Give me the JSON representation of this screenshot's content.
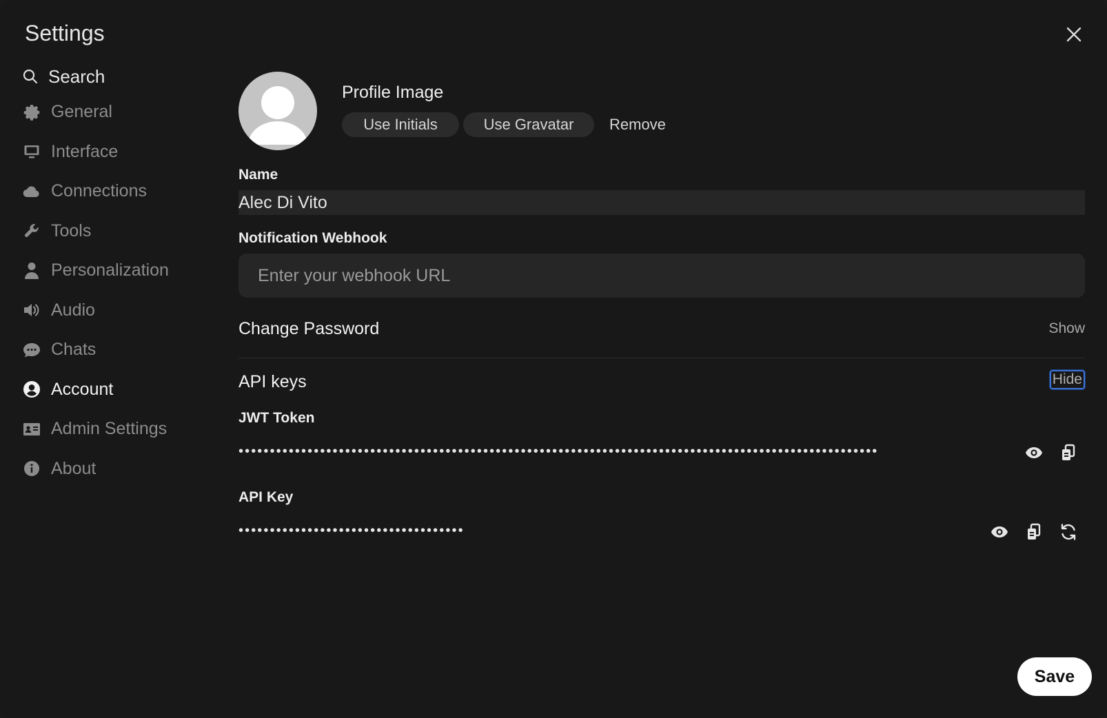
{
  "header": {
    "title": "Settings"
  },
  "sidebar": {
    "search_label": "Search",
    "items": [
      {
        "label": "General",
        "icon": "gear-icon"
      },
      {
        "label": "Interface",
        "icon": "monitor-icon"
      },
      {
        "label": "Connections",
        "icon": "cloud-icon"
      },
      {
        "label": "Tools",
        "icon": "wrench-icon"
      },
      {
        "label": "Personalization",
        "icon": "user-icon"
      },
      {
        "label": "Audio",
        "icon": "speaker-icon"
      },
      {
        "label": "Chats",
        "icon": "chat-bubble-icon"
      },
      {
        "label": "Account",
        "icon": "user-circle-icon"
      },
      {
        "label": "Admin Settings",
        "icon": "id-card-icon"
      },
      {
        "label": "About",
        "icon": "info-icon"
      }
    ],
    "active": "Account"
  },
  "profile": {
    "label": "Profile Image",
    "use_initials": "Use Initials",
    "use_gravatar": "Use Gravatar",
    "remove": "Remove"
  },
  "name": {
    "label": "Name",
    "value": "Alec Di Vito"
  },
  "webhook": {
    "label": "Notification Webhook",
    "placeholder": "Enter your webhook URL"
  },
  "password": {
    "title": "Change Password",
    "toggle": "Show"
  },
  "api": {
    "title": "API keys",
    "toggle": "Hide",
    "jwt_label": "JWT Token",
    "jwt_masked": "••••••••••••••••••••••••••••••••••••••••••••••••••••••••••••••••••••••••••••••••••••••••••••••••••••••",
    "key_label": "API Key",
    "key_masked": "••••••••••••••••••••••••••••••••••••"
  },
  "footer": {
    "save": "Save"
  },
  "colors": {
    "background": "#181818",
    "input": "#262626",
    "focus": "#3b74d9"
  }
}
